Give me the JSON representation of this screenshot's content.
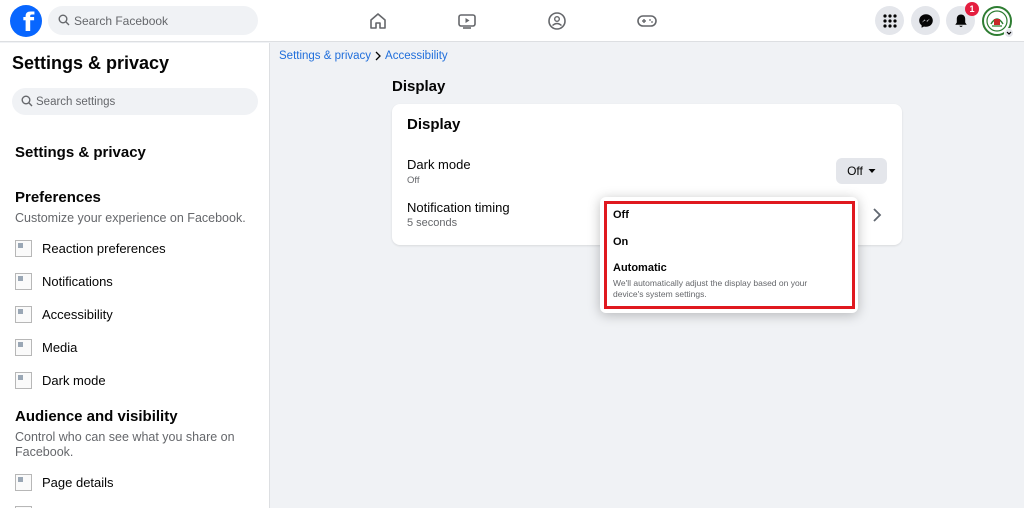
{
  "topbar": {
    "logo_letter": "f",
    "search_placeholder": "Search Facebook",
    "notification_count": "1"
  },
  "sidebar": {
    "title": "Settings & privacy",
    "search_placeholder": "Search settings",
    "section_title": "Settings & privacy",
    "preferences": {
      "title": "Preferences",
      "subtitle": "Customize your experience on Facebook.",
      "items": [
        {
          "label": "Reaction preferences"
        },
        {
          "label": "Notifications"
        },
        {
          "label": "Accessibility"
        },
        {
          "label": "Media"
        },
        {
          "label": "Dark mode"
        }
      ]
    },
    "audience": {
      "title": "Audience and visibility",
      "subtitle": "Control who can see what you share on Facebook.",
      "items": [
        {
          "label": "Page details"
        }
      ]
    }
  },
  "breadcrumb": {
    "parent": "Settings & privacy",
    "current": "Accessibility"
  },
  "main": {
    "section_title": "Display",
    "card_title": "Display",
    "dark_mode": {
      "label": "Dark mode",
      "value": "Off",
      "button_label": "Off"
    },
    "notification_timing": {
      "label": "Notification timing",
      "value": "5 seconds"
    }
  },
  "dropdown": {
    "options": [
      {
        "label": "Off"
      },
      {
        "label": "On"
      },
      {
        "label": "Automatic",
        "description": "We'll automatically adjust the display based on your device's system settings."
      }
    ]
  },
  "colors": {
    "brand": "#0866ff",
    "link": "#216fdb",
    "highlight": "#e0181f",
    "badge": "#e41e3f"
  }
}
